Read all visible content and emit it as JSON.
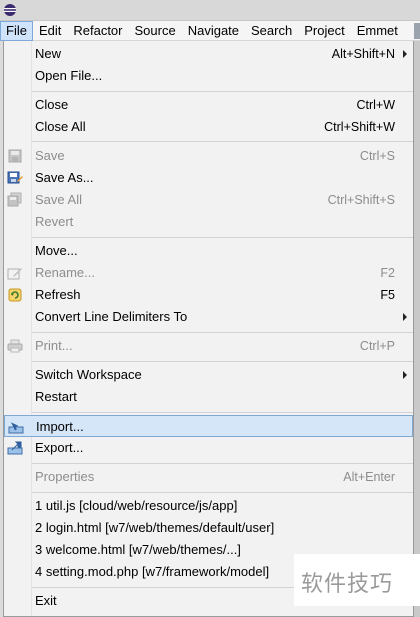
{
  "menubar": {
    "items": [
      "File",
      "Edit",
      "Refactor",
      "Source",
      "Navigate",
      "Search",
      "Project",
      "Emmet"
    ]
  },
  "file_menu": {
    "new": {
      "label": "New",
      "shortcut": "Alt+Shift+N"
    },
    "open_file": {
      "label": "Open File..."
    },
    "close": {
      "label": "Close",
      "shortcut": "Ctrl+W"
    },
    "close_all": {
      "label": "Close All",
      "shortcut": "Ctrl+Shift+W"
    },
    "save": {
      "label": "Save",
      "shortcut": "Ctrl+S"
    },
    "save_as": {
      "label": "Save As..."
    },
    "save_all": {
      "label": "Save All",
      "shortcut": "Ctrl+Shift+S"
    },
    "revert": {
      "label": "Revert"
    },
    "move": {
      "label": "Move..."
    },
    "rename": {
      "label": "Rename...",
      "shortcut": "F2"
    },
    "refresh": {
      "label": "Refresh",
      "shortcut": "F5"
    },
    "convert": {
      "label": "Convert Line Delimiters To"
    },
    "print": {
      "label": "Print...",
      "shortcut": "Ctrl+P"
    },
    "switch_workspace": {
      "label": "Switch Workspace"
    },
    "restart": {
      "label": "Restart"
    },
    "import": {
      "label": "Import..."
    },
    "export": {
      "label": "Export..."
    },
    "properties": {
      "label": "Properties",
      "shortcut": "Alt+Enter"
    },
    "recent": [
      "1 util.js  [cloud/web/resource/js/app]",
      "2 login.html  [w7/web/themes/default/user]",
      "3 welcome.html  [w7/web/themes/...]",
      "4 setting.mod.php  [w7/framework/model]"
    ],
    "exit": {
      "label": "Exit"
    }
  },
  "watermark": {
    "text": "软件技巧"
  },
  "colors": {
    "highlight": "#d5e6f8",
    "highlight_border": "#7fa8d3",
    "disabled_text": "#8d8d8d",
    "menu_background": "#f2f2f2"
  }
}
